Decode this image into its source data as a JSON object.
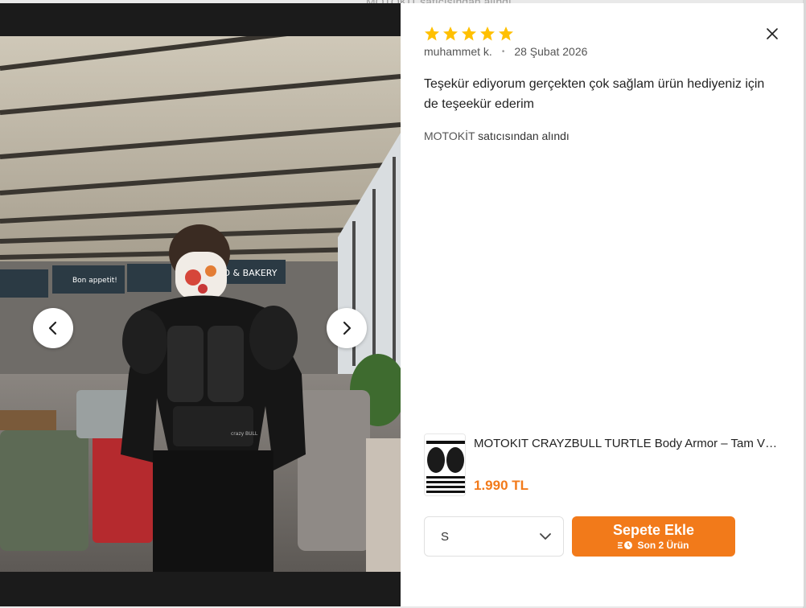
{
  "background": {
    "peek_text": "MOTOKİT satıcısından alındı"
  },
  "gallery": {
    "prev_icon": "chevron-left-icon",
    "next_icon": "chevron-right-icon",
    "photo_signs": {
      "sign1": "Bon appetit!",
      "sign2": "AD & BAKERY",
      "armor_brand": "crazy BULL"
    }
  },
  "review": {
    "rating": 5,
    "author": "muhammet k.",
    "separator": "•",
    "date": "28 Şubat 2026",
    "text": "Teşekür ediyorum gerçekten çok sağlam ürün hediyeniz için de teşeekür ederim",
    "seller_name": "MOTOKİT",
    "seller_suffix": "satıcısından alındı"
  },
  "product": {
    "title": "MOTOKIT CRAYZBULL TURTLE Body Armor – Tam Vücut Koruma",
    "price": "1.990 TL"
  },
  "controls": {
    "size_value": "S",
    "add_to_cart_label": "Sepete Ekle",
    "stock_label": "Son 2 Ürün"
  },
  "colors": {
    "accent": "#f27a1a",
    "star": "#ffc000"
  }
}
